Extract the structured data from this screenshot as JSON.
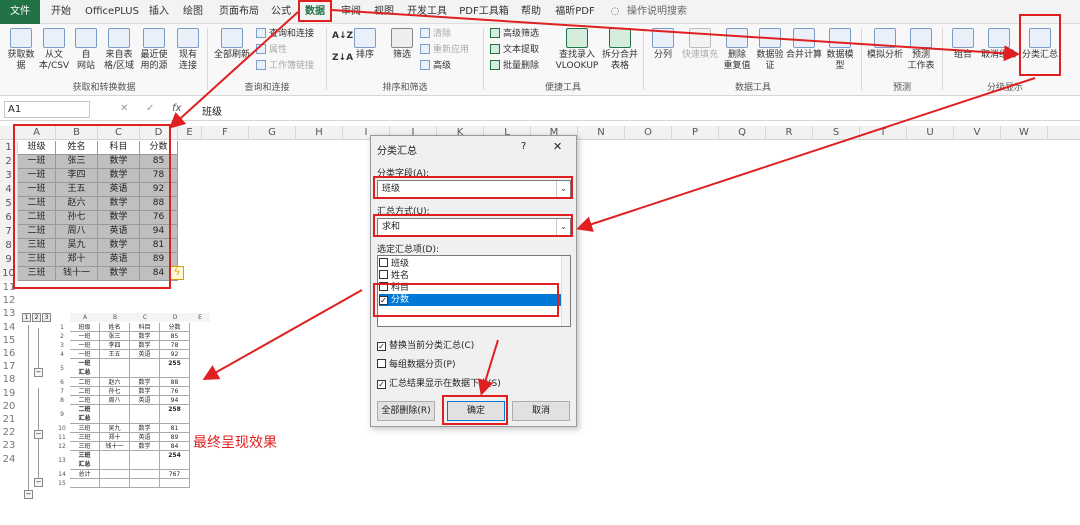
{
  "menu": {
    "tabs": [
      "文件",
      "开始",
      "OfficePLUS",
      "插入",
      "绘图",
      "页面布局",
      "公式",
      "数据",
      "审阅",
      "视图",
      "开发工具",
      "PDF工具箱",
      "帮助",
      "福昕PDF"
    ],
    "search": "操作说明搜索"
  },
  "ribbon": {
    "get_data": {
      "btn1": "获取数",
      "btn1b": "据",
      "btn2": "从文",
      "btn2b": "本/CSV",
      "btn3": "自",
      "btn3b": "网站",
      "btn4": "来自表",
      "btn4b": "格/区域",
      "btn5": "最近使",
      "btn5b": "用的源",
      "btn6": "现有",
      "btn6b": "连接",
      "group": "获取和转换数据"
    },
    "queries": {
      "refresh": "全部刷新",
      "q1": "查询和连接",
      "q2": "属性",
      "q3": "工作簿链接",
      "group": "查询和连接"
    },
    "sort": {
      "az": "A↓Z",
      "za": "Z↓A",
      "sort": "排序",
      "filter": "筛选",
      "clear": "清除",
      "reapply": "重新应用",
      "advanced": "高级",
      "group": "排序和筛选"
    },
    "tools_a": {
      "adv_filter": "高级筛选",
      "text_extract": "文本提取",
      "batch_delete": "批量删除",
      "lookup1": "查找录入",
      "lookup2": "VLOOKUP",
      "split1": "拆分合并",
      "split2": "表格",
      "group": "便捷工具"
    },
    "data_tools": {
      "split": "分列",
      "flash": "快速填充",
      "dedupe1": "删除",
      "dedupe2": "重复值",
      "valid1": "数据验",
      "valid2": "证",
      "consol": "合并计算",
      "model1": "数据模",
      "model2": "型",
      "group": "数据工具"
    },
    "forecast": {
      "whatif": "模拟分析",
      "sheet1": "预测",
      "sheet2": "工作表",
      "group": "预测"
    },
    "outline": {
      "group_btn": "组合",
      "ungroup": "取消组合",
      "subtotal": "分类汇总",
      "group": "分级显示"
    }
  },
  "formula_bar": {
    "namebox": "A1",
    "fx": "fx",
    "value": "班级",
    "cancel": "✕",
    "confirm": "✓"
  },
  "columns": [
    "A",
    "B",
    "C",
    "D",
    "E",
    "F",
    "G",
    "H",
    "I",
    "J",
    "K",
    "L",
    "M",
    "N",
    "O",
    "P",
    "Q",
    "R",
    "S",
    "T",
    "U",
    "V",
    "W"
  ],
  "table": {
    "headers": [
      "班级",
      "姓名",
      "科目",
      "分数"
    ],
    "rows": [
      [
        "一班",
        "张三",
        "数学",
        "85"
      ],
      [
        "一班",
        "李四",
        "数学",
        "78"
      ],
      [
        "一班",
        "王五",
        "英语",
        "92"
      ],
      [
        "二班",
        "赵六",
        "数学",
        "88"
      ],
      [
        "二班",
        "孙七",
        "数学",
        "76"
      ],
      [
        "二班",
        "周八",
        "英语",
        "94"
      ],
      [
        "三班",
        "吴九",
        "数学",
        "81"
      ],
      [
        "三班",
        "郑十",
        "英语",
        "89"
      ],
      [
        "三班",
        "钱十一",
        "数学",
        "84"
      ]
    ]
  },
  "dialog": {
    "title": "分类汇总",
    "help": "?",
    "close": "✕",
    "field_label": "分类字段(A):",
    "field_value": "班级",
    "method_label": "汇总方式(U):",
    "method_value": "求和",
    "items_label": "选定汇总项(D):",
    "items": [
      "班级",
      "姓名",
      "科目",
      "分数"
    ],
    "items_checked": [
      false,
      false,
      false,
      true
    ],
    "opt1": "替换当前分类汇总(C)",
    "opt2": "每组数据分页(P)",
    "opt3": "汇总结果显示在数据下方(S)",
    "opt_checked": [
      true,
      false,
      true
    ],
    "delete_all": "全部删除(R)",
    "ok": "确定",
    "cancel": "取消"
  },
  "result": {
    "caption": "最终呈现效果",
    "levels": [
      "1",
      "2",
      "3"
    ],
    "big_row_labels": [
      "11",
      "12",
      "13",
      "14",
      "15",
      "16",
      "17",
      "18",
      "19",
      "20",
      "21",
      "22",
      "23",
      "24"
    ],
    "headers": [
      "班级",
      "姓名",
      "科目",
      "分数"
    ],
    "cols": [
      "A",
      "B",
      "C",
      "D",
      "E"
    ],
    "rows": [
      {
        "n": "1",
        "c": [
          "班级",
          "姓名",
          "科目",
          "分数"
        ]
      },
      {
        "n": "2",
        "c": [
          "一班",
          "张三",
          "数学",
          "85"
        ]
      },
      {
        "n": "3",
        "c": [
          "一班",
          "李四",
          "数学",
          "78"
        ]
      },
      {
        "n": "4",
        "c": [
          "一班",
          "王五",
          "英语",
          "92"
        ]
      },
      {
        "n": "5",
        "c": [
          "一班\n汇总",
          "",
          "",
          "255"
        ]
      },
      {
        "n": "6",
        "c": [
          "二班",
          "赵六",
          "数学",
          "88"
        ]
      },
      {
        "n": "7",
        "c": [
          "二班",
          "孙七",
          "数学",
          "76"
        ]
      },
      {
        "n": "8",
        "c": [
          "二班",
          "周八",
          "英语",
          "94"
        ]
      },
      {
        "n": "9",
        "c": [
          "二班\n汇总",
          "",
          "",
          "258"
        ]
      },
      {
        "n": "10",
        "c": [
          "三班",
          "吴九",
          "数学",
          "81"
        ]
      },
      {
        "n": "11",
        "c": [
          "三班",
          "郑十",
          "英语",
          "89"
        ]
      },
      {
        "n": "12",
        "c": [
          "三班",
          "钱十一",
          "数学",
          "84"
        ]
      },
      {
        "n": "13",
        "c": [
          "三班\n汇总",
          "",
          "",
          "254"
        ]
      },
      {
        "n": "14",
        "c": [
          "总计",
          "",
          "",
          "767"
        ]
      },
      {
        "n": "15",
        "c": [
          "",
          "",
          "",
          ""
        ]
      }
    ]
  },
  "colors": {
    "accent": "#217346",
    "annotation": "#e02020",
    "selected": "#0078d7"
  }
}
